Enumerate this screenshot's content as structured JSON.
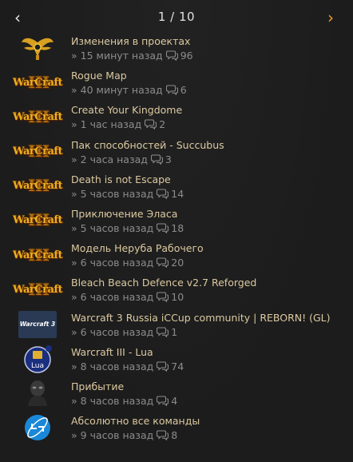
{
  "pager": {
    "current": "1 / 10",
    "prev_icon": "chevron-left-icon",
    "next_icon": "chevron-right-icon",
    "next_color": "#f0a020"
  },
  "meta_prefix": "»",
  "items": [
    {
      "title": "Изменения в проектах",
      "time": "15 минут назад",
      "comments": "96",
      "thumb": "winged-emblem"
    },
    {
      "title": "Rogue Map",
      "time": "40 минут назад",
      "comments": "6",
      "thumb": "warcraft-3-logo"
    },
    {
      "title": "Create Your Kingdome",
      "time": "1 час назад",
      "comments": "2",
      "thumb": "warcraft-3-logo"
    },
    {
      "title": "Пак способностей - Succubus",
      "time": "2 часа назад",
      "comments": "3",
      "thumb": "warcraft-3-logo"
    },
    {
      "title": "Death is not Escape",
      "time": "5 часов назад",
      "comments": "14",
      "thumb": "warcraft-3-logo"
    },
    {
      "title": "Приключение Эласа",
      "time": "5 часов назад",
      "comments": "18",
      "thumb": "warcraft-3-logo"
    },
    {
      "title": "Модель Неруба Рабочего",
      "time": "6 часов назад",
      "comments": "20",
      "thumb": "warcraft-3-logo"
    },
    {
      "title": "Bleach Beach Defence v2.7 Reforged",
      "time": "6 часов назад",
      "comments": "10",
      "thumb": "warcraft-3-logo"
    },
    {
      "title": "Warcraft 3 Russia iCCup community | REBORN! (GL)",
      "time": "6 часов назад",
      "comments": "1",
      "thumb": "warcraft3-community-badge",
      "thumb_text": "Warcraft 3"
    },
    {
      "title": "Warcraft III - Lua",
      "time": "8 часов назад",
      "comments": "74",
      "thumb": "lua-logo",
      "thumb_text": "Lua"
    },
    {
      "title": "Прибытие",
      "time": "8 часов назад",
      "comments": "4",
      "thumb": "dark-figure-avatar"
    },
    {
      "title": "Абсолютно все команды",
      "time": "9 часов назад",
      "comments": "8",
      "thumb": "sync-globe-icon"
    }
  ],
  "logo_text": "WarCraft"
}
